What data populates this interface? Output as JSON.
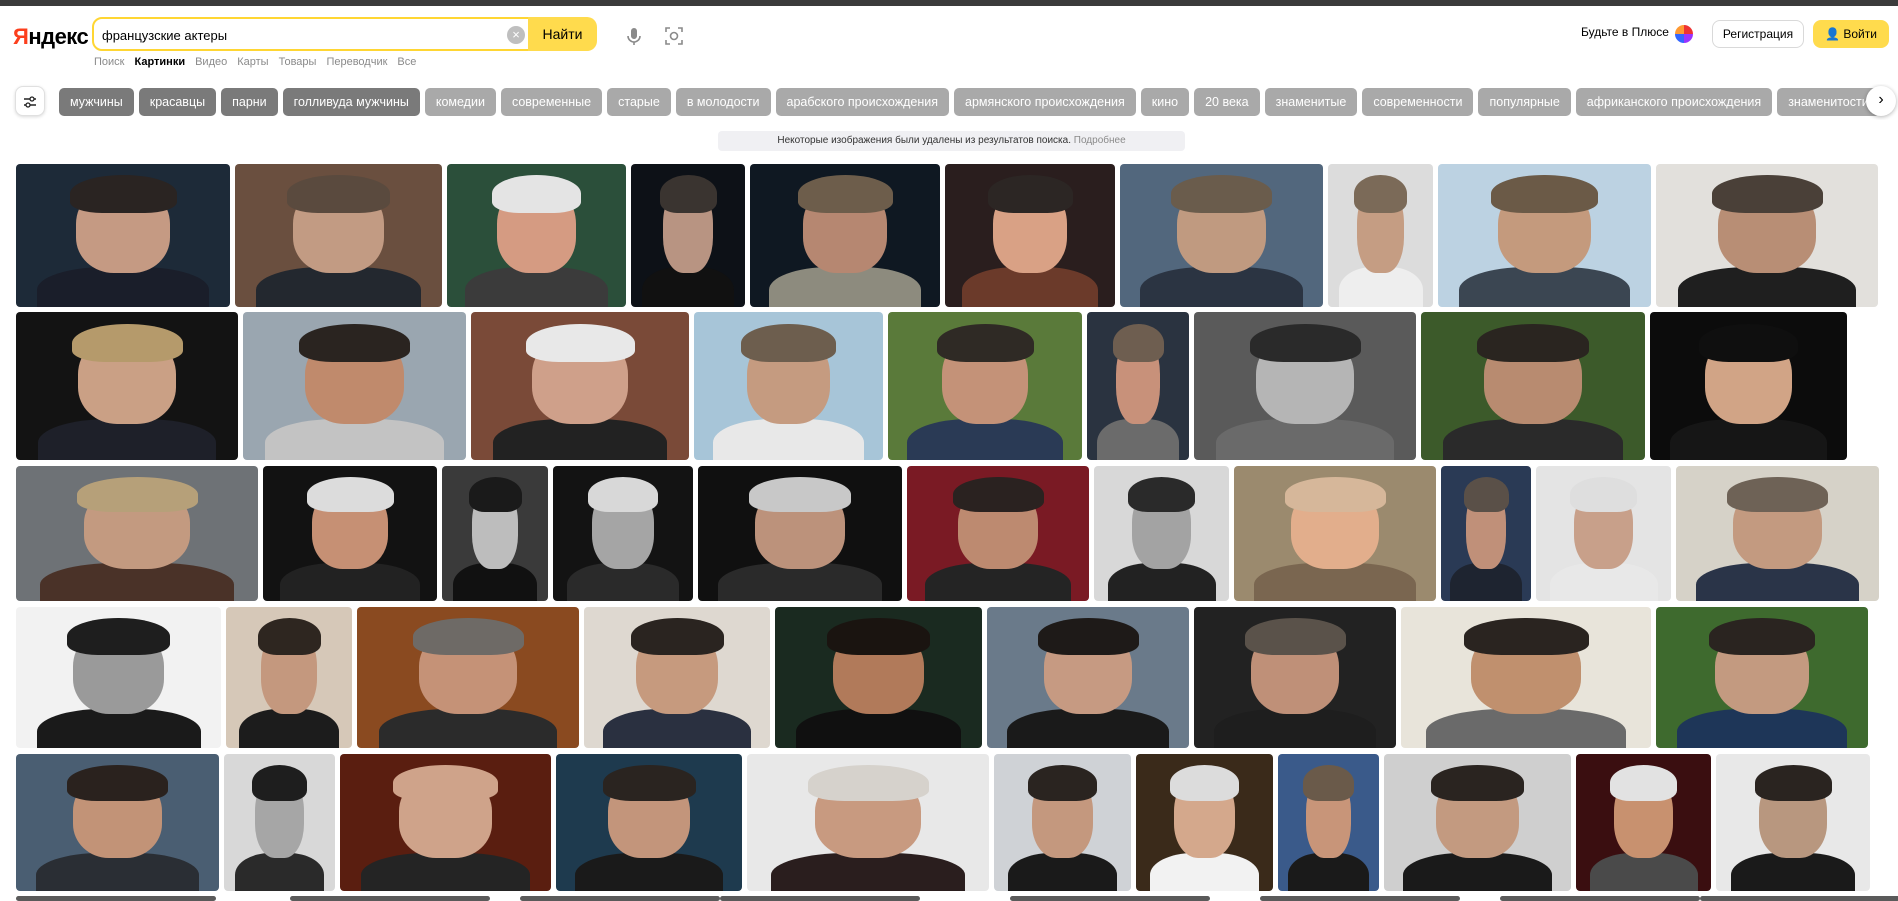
{
  "logo": {
    "text_a": "Я",
    "text_b": "ндекс"
  },
  "search": {
    "query": "французские актеры",
    "button": "Найти",
    "clear": "×"
  },
  "tabs": [
    {
      "label": "Поиск",
      "active": false
    },
    {
      "label": "Картинки",
      "active": true
    },
    {
      "label": "Видео",
      "active": false
    },
    {
      "label": "Карты",
      "active": false
    },
    {
      "label": "Товары",
      "active": false
    },
    {
      "label": "Переводчик",
      "active": false
    },
    {
      "label": "Все",
      "active": false
    }
  ],
  "header_right": {
    "plus": "Будьте в Плюсе",
    "register": "Регистрация",
    "login": "Войти"
  },
  "chips": [
    "мужчины",
    "красавцы",
    "парни",
    "голливуда мужчины",
    "комедии",
    "современные",
    "старые",
    "в молодости",
    "арабского происхождения",
    "армянского происхождения",
    "кино",
    "20 века",
    "знаменитые",
    "современности",
    "популярные",
    "африканского происхождения",
    "знаменитости"
  ],
  "dark_chip_count": 4,
  "notice": {
    "text": "Некоторые изображения были удалены из результатов поиска.",
    "link": "Подробнее"
  },
  "colors": {
    "accent": "#ffdb4d",
    "chip": "#a9a9a9",
    "chip_dark": "#7a7a7a"
  },
  "image_rows": [
    {
      "tiles": [
        {
          "bg": "#1d2a38",
          "skin": "#c59a83",
          "hair": "#2a2422",
          "cloth": "#1a1e2a"
        },
        {
          "bg": "#6a4f3f",
          "skin": "#c29b83",
          "hair": "#5a4a3e",
          "cloth": "#23282f"
        },
        {
          "bg": "#2b4f3a",
          "skin": "#d59b82",
          "hair": "#e4e4e4",
          "cloth": "#3b3b3b"
        },
        {
          "bg": "#0d1117",
          "skin": "#b89482",
          "hair": "#3a3430",
          "cloth": "#111111"
        },
        {
          "bg": "#0f1822",
          "skin": "#b68771",
          "hair": "#6d5d4b",
          "cloth": "#8d8b7e"
        },
        {
          "bg": "#2a1e1e",
          "skin": "#d9a185",
          "hair": "#2c2624",
          "cloth": "#6b3a2a"
        },
        {
          "bg": "#52677d",
          "skin": "#c09a80",
          "hair": "#6a5c4c",
          "cloth": "#2b3442"
        },
        {
          "bg": "#dcdcdc",
          "skin": "#c59d83",
          "hair": "#7b6a58",
          "cloth": "#eeeeee"
        },
        {
          "bg": "#bcd2e2",
          "skin": "#c49a7d",
          "hair": "#6b5a47",
          "cloth": "#3b4652"
        },
        {
          "bg": "#e2e0dc",
          "skin": "#b88e75",
          "hair": "#4a4038",
          "cloth": "#1f1f1f"
        }
      ]
    },
    {
      "tiles": [
        {
          "bg": "#131313",
          "skin": "#caa085",
          "hair": "#b59a6b",
          "cloth": "#1e2029"
        },
        {
          "bg": "#9aa6b0",
          "skin": "#c08a6c",
          "hair": "#2a2420",
          "cloth": "#c3c3c3"
        },
        {
          "bg": "#7a4a38",
          "skin": "#cfa08a",
          "hair": "#e8e8e8",
          "cloth": "#222222"
        },
        {
          "bg": "#a7c5d8",
          "skin": "#c59b80",
          "hair": "#6d5e4e",
          "cloth": "#e8e8e8"
        },
        {
          "bg": "#5a7a3a",
          "skin": "#c49278",
          "hair": "#2f2a25",
          "cloth": "#2a3a55"
        },
        {
          "bg": "#2a3340",
          "skin": "#c8917a",
          "hair": "#6e5e50",
          "cloth": "#6b6b6b"
        },
        {
          "bg": "#5a5a5a",
          "skin": "#b5b5b5",
          "hair": "#2a2a2a",
          "cloth": "#6a6a6a"
        },
        {
          "bg": "#3c5a2a",
          "skin": "#b88b70",
          "hair": "#2a2520",
          "cloth": "#2a2a2a"
        },
        {
          "bg": "#0c0c0c",
          "skin": "#d1a486",
          "hair": "#0f0f0f",
          "cloth": "#161616"
        }
      ]
    },
    {
      "tiles": [
        {
          "bg": "#6e7276",
          "skin": "#c39a80",
          "hair": "#b6a079",
          "cloth": "#4a3228"
        },
        {
          "bg": "#121212",
          "skin": "#c69074",
          "hair": "#dcdcdc",
          "cloth": "#222222"
        },
        {
          "bg": "#3a3a3a",
          "skin": "#bdbdbd",
          "hair": "#1a1a1a",
          "cloth": "#111111"
        },
        {
          "bg": "#131313",
          "skin": "#a5a5a5",
          "hair": "#d8d8d8",
          "cloth": "#2a2a2a"
        },
        {
          "bg": "#101010",
          "skin": "#bc927b",
          "hair": "#c8c8c8",
          "cloth": "#2a2a2a"
        },
        {
          "bg": "#7a1a24",
          "skin": "#bd8a70",
          "hair": "#2a2220",
          "cloth": "#242424"
        },
        {
          "bg": "#d8d8d8",
          "skin": "#a3a3a3",
          "hair": "#2a2a2a",
          "cloth": "#222222"
        },
        {
          "bg": "#9b8a6e",
          "skin": "#e2ae8c",
          "hair": "#d6b79a",
          "cloth": "#7a6650"
        },
        {
          "bg": "#2a3a55",
          "skin": "#c09079",
          "hair": "#5a5048",
          "cloth": "#1e2430"
        },
        {
          "bg": "#e4e4e4",
          "skin": "#c8a08a",
          "hair": "#dedede",
          "cloth": "#e8e8e8"
        },
        {
          "bg": "#d6d2c8",
          "skin": "#c39a80",
          "hair": "#6e6256",
          "cloth": "#2a3448"
        }
      ]
    },
    {
      "tiles": [
        {
          "bg": "#f2f2f2",
          "skin": "#9a9a9a",
          "hair": "#1e1e1e",
          "cloth": "#1a1a1a"
        },
        {
          "bg": "#d6c8b8",
          "skin": "#c4987e",
          "hair": "#2e2620",
          "cloth": "#1c1c1c"
        },
        {
          "bg": "#8a4a20",
          "skin": "#c59277",
          "hair": "#6e6a66",
          "cloth": "#2b2b2b"
        },
        {
          "bg": "#ded8d0",
          "skin": "#c69a7e",
          "hair": "#2a2420",
          "cloth": "#2a3040"
        },
        {
          "bg": "#1a2a20",
          "skin": "#b17a5a",
          "hair": "#1a1410",
          "cloth": "#101010"
        },
        {
          "bg": "#6a7a8a",
          "skin": "#c69a82",
          "hair": "#1e1a18",
          "cloth": "#1a1a1a"
        },
        {
          "bg": "#222222",
          "skin": "#bf9078",
          "hair": "#5a524a",
          "cloth": "#1e1e1e"
        },
        {
          "bg": "#e8e4da",
          "skin": "#c0906e",
          "hair": "#2a2420",
          "cloth": "#6a6a6a"
        },
        {
          "bg": "#3e6a2e",
          "skin": "#c39a80",
          "hair": "#2a2420",
          "cloth": "#1e3658"
        }
      ]
    },
    {
      "tiles": [
        {
          "bg": "#4a5e72",
          "skin": "#c29377",
          "hair": "#2a221e",
          "cloth": "#2a2e34"
        },
        {
          "bg": "#d8d8d8",
          "skin": "#a6a6a6",
          "hair": "#1e1e1e",
          "cloth": "#2a2a2a"
        },
        {
          "bg": "#5a1e10",
          "skin": "#cfa38a",
          "hair": "#cfa38a",
          "cloth": "#242424"
        },
        {
          "bg": "#1e3a4e",
          "skin": "#c3957b",
          "hair": "#2a2420",
          "cloth": "#1a1a1a"
        },
        {
          "bg": "#e8e8e8",
          "skin": "#c89a80",
          "hair": "#d6d2cc",
          "cloth": "#2a1e1e"
        },
        {
          "bg": "#cfd2d6",
          "skin": "#c4987e",
          "hair": "#2a2420",
          "cloth": "#1a1a1a"
        },
        {
          "bg": "#3a2a1a",
          "skin": "#d4a88c",
          "hair": "#dcdcdc",
          "cloth": "#f2f2f2"
        },
        {
          "bg": "#3a5a8a",
          "skin": "#c89579",
          "hair": "#6a5a4a",
          "cloth": "#1a1a1a"
        },
        {
          "bg": "#cfcfcf",
          "skin": "#c39a80",
          "hair": "#2a2420",
          "cloth": "#1a1a1a"
        },
        {
          "bg": "#3a0e10",
          "skin": "#c8916f",
          "hair": "#e2e2e2",
          "cloth": "#4a4a4a"
        },
        {
          "bg": "#e8e8e8",
          "skin": "#b8977f",
          "hair": "#2a2420",
          "cloth": "#1a1a1a"
        }
      ]
    }
  ]
}
